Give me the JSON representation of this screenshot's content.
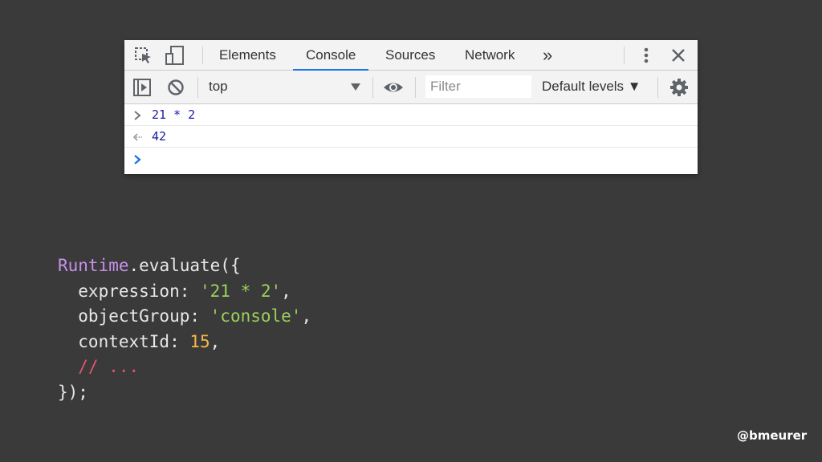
{
  "devtools": {
    "tabs": [
      {
        "label": "Elements"
      },
      {
        "label": "Console"
      },
      {
        "label": "Sources"
      },
      {
        "label": "Network"
      }
    ],
    "more_tabs_glyph": "»",
    "toolbar": {
      "context_value": "top",
      "filter_placeholder": "Filter",
      "levels_label": "Default levels ▼"
    },
    "console": {
      "input_line": "21 * 2",
      "result_line": "42"
    },
    "icons": [
      "inspect-element-icon",
      "device-toolbar-icon",
      "more-tabs-icon",
      "kebab-menu-icon",
      "close-icon",
      "sidebar-toggle-icon",
      "clear-console-icon",
      "dropdown-arrow-icon",
      "eye-icon",
      "gear-icon",
      "prompt-chevron-icon",
      "result-arrow-icon"
    ],
    "accent_color": "#1a73e8"
  },
  "code": {
    "line1_obj": "Runtime",
    "line1_rest": ".evaluate({",
    "line2_key": "  expression: ",
    "line2_val": "'21 * 2'",
    "line2_end": ",",
    "line3_key": "  objectGroup: ",
    "line3_val": "'console'",
    "line3_end": ",",
    "line4_key": "  contextId: ",
    "line4_val": "15",
    "line4_end": ",",
    "line5_comment": "  // ...",
    "line6": "});"
  },
  "credit": "@bmeurer"
}
